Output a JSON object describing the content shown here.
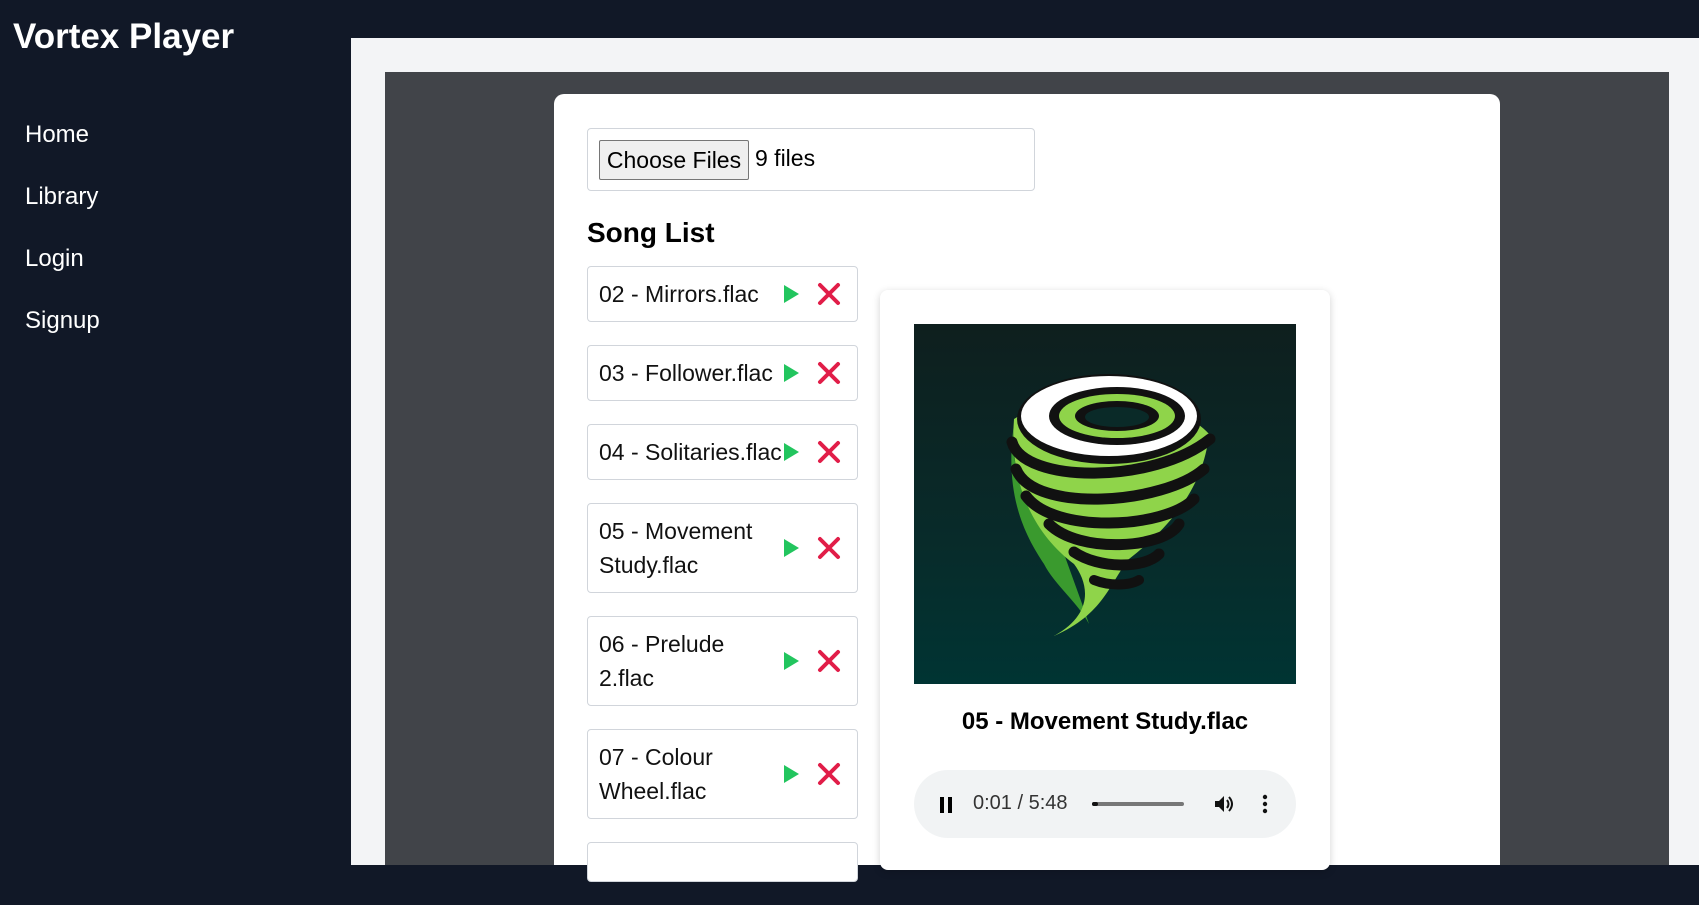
{
  "app": {
    "title": "Vortex Player"
  },
  "nav": {
    "items": [
      {
        "label": "Home"
      },
      {
        "label": "Library"
      },
      {
        "label": "Login"
      },
      {
        "label": "Signup"
      }
    ]
  },
  "upload": {
    "button_label": "Choose Files",
    "status": "9 files"
  },
  "song_list": {
    "title": "Song List",
    "items": [
      {
        "name": "02 - Mirrors.flac"
      },
      {
        "name": "03 - Follower.flac"
      },
      {
        "name": "04 - Solitaries.flac"
      },
      {
        "name": "05 - Movement Study.flac"
      },
      {
        "name": "06 - Prelude 2.flac"
      },
      {
        "name": "07 - Colour Wheel.flac"
      }
    ]
  },
  "player": {
    "now_playing": "05 - Movement Study.flac",
    "time_display": "0:01 / 5:48",
    "progress_fraction": 0.003,
    "cover_icon": "tornado-icon"
  },
  "colors": {
    "sidebar_bg": "#111827",
    "play": "#22c55e",
    "delete": "#e11d48",
    "tornado_green": "#8fd44a"
  }
}
